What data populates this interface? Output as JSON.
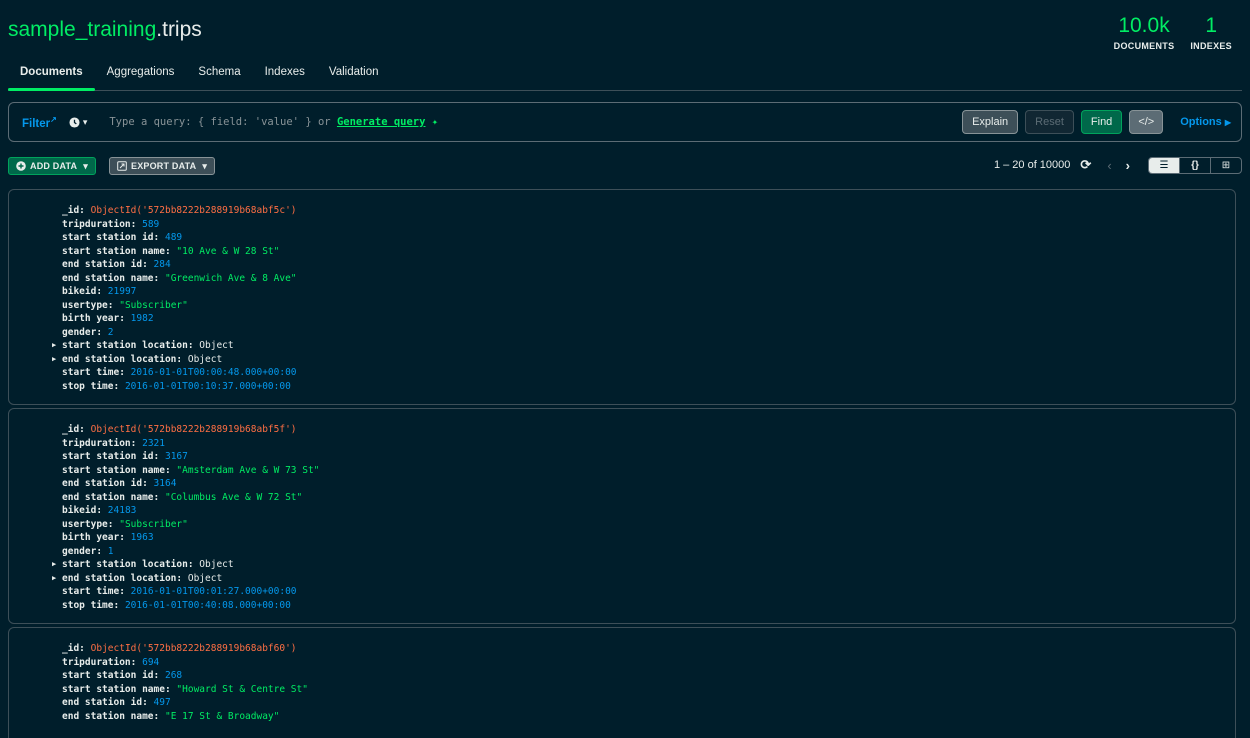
{
  "collection": {
    "db": "sample_training",
    "sep": ".",
    "name": "trips"
  },
  "stats": {
    "documents_value": "10.0k",
    "documents_label": "DOCUMENTS",
    "indexes_value": "1",
    "indexes_label": "INDEXES"
  },
  "tabs": [
    "Documents",
    "Aggregations",
    "Schema",
    "Indexes",
    "Validation"
  ],
  "query": {
    "filter_label": "Filter",
    "placeholder": "Type a query: { field: 'value' } or",
    "generate_label": "Generate query",
    "explain": "Explain",
    "reset": "Reset",
    "find": "Find",
    "options": "Options"
  },
  "toolbar": {
    "add_data": "ADD DATA",
    "export_data": "EXPORT DATA",
    "pagination": "1 – 20 of 10000"
  },
  "documents": [
    {
      "_id": "ObjectId('572bb8222b288919b68abf5c')",
      "tripduration": "589",
      "start_station_id": "489",
      "start_station_name": "\"10 Ave & W 28 St\"",
      "end_station_id": "284",
      "end_station_name": "\"Greenwich Ave & 8 Ave\"",
      "bikeid": "21997",
      "usertype": "\"Subscriber\"",
      "birth_year": "1982",
      "gender": "2",
      "start_station_location": "Object",
      "end_station_location": "Object",
      "start_time": "2016-01-01T00:00:48.000+00:00",
      "stop_time": "2016-01-01T00:10:37.000+00:00"
    },
    {
      "_id": "ObjectId('572bb8222b288919b68abf5f')",
      "tripduration": "2321",
      "start_station_id": "3167",
      "start_station_name": "\"Amsterdam Ave & W 73 St\"",
      "end_station_id": "3164",
      "end_station_name": "\"Columbus Ave & W 72 St\"",
      "bikeid": "24183",
      "usertype": "\"Subscriber\"",
      "birth_year": "1963",
      "gender": "1",
      "start_station_location": "Object",
      "end_station_location": "Object",
      "start_time": "2016-01-01T00:01:27.000+00:00",
      "stop_time": "2016-01-01T00:40:08.000+00:00"
    },
    {
      "_id": "ObjectId('572bb8222b288919b68abf60')",
      "tripduration": "694",
      "start_station_id": "268",
      "start_station_name": "\"Howard St & Centre St\"",
      "end_station_id": "497",
      "end_station_name": "\"E 17 St & Broadway\""
    }
  ],
  "field_labels": {
    "_id": "_id:",
    "tripduration": "tripduration:",
    "start_station_id": "start station id:",
    "start_station_name": "start station name:",
    "end_station_id": "end station id:",
    "end_station_name": "end station name:",
    "bikeid": "bikeid:",
    "usertype": "usertype:",
    "birth_year": "birth year:",
    "gender": "gender:",
    "start_station_location": "start station location:",
    "end_station_location": "end station location:",
    "start_time": "start time:",
    "stop_time": "stop time:"
  },
  "colors": {
    "accent": "#00ed64",
    "link": "#0498ec",
    "objectid": "#ff6f44",
    "background": "#001e2b"
  }
}
